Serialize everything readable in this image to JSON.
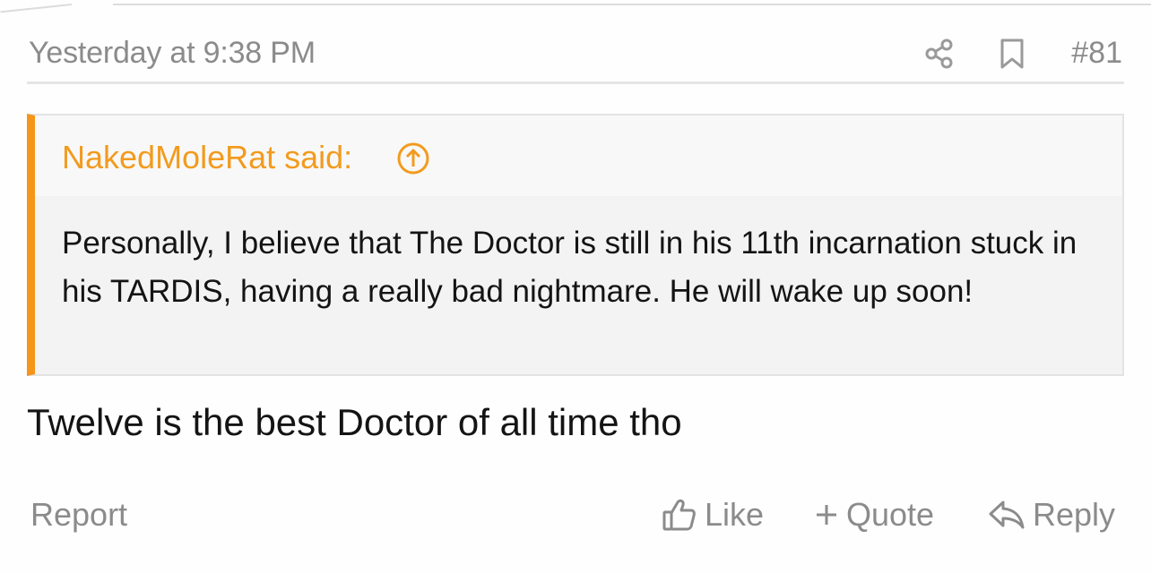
{
  "post": {
    "timestamp": "Yesterday at 9:38 PM",
    "number": "#81",
    "quote": {
      "author": "NakedMoleRat said:",
      "text": "Personally, I believe that The Doctor is still in his 11th incarnation stuck in his TARDIS, having a really bad nightmare. He will wake up soon!"
    },
    "message": "Twelve is the best Doctor of all time tho"
  },
  "actions": {
    "report": "Report",
    "like": "Like",
    "quote": "Quote",
    "reply": "Reply"
  },
  "icons": {
    "share": "share-icon",
    "bookmark": "bookmark-icon",
    "quote_jump": "arrow-up-circle-icon",
    "like": "thumbs-up-icon",
    "quote": "plus-icon",
    "reply": "reply-arrow-icon"
  },
  "colors": {
    "accent": "#f5951a",
    "muted_text": "#8b8b8b",
    "quote_bg": "#f3f3f3"
  }
}
